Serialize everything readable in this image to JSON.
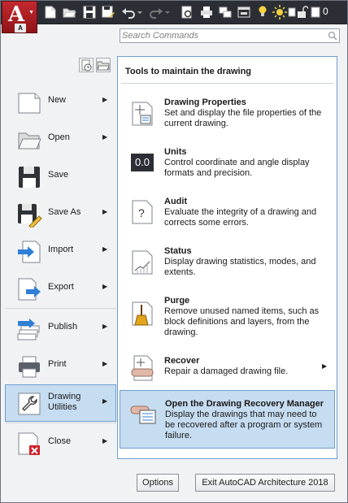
{
  "app_menu": {
    "letter": "A"
  },
  "quick_access": {
    "icons": [
      "new-icon",
      "open-icon",
      "save-icon",
      "save-as-icon",
      "undo-icon",
      "redo-icon",
      "plot-preview-icon",
      "plot-icon",
      "workspace-icon",
      "lightbulb-icon",
      "sun-icon",
      "layer-icon",
      "unlock-icon",
      "color-swatch-icon"
    ],
    "layer_value": "0"
  },
  "search": {
    "placeholder": "Search Commands",
    "value": ""
  },
  "menu": {
    "items": [
      {
        "label": "New",
        "icon": "new-document-icon",
        "has_arrow": true
      },
      {
        "label": "Open",
        "icon": "open-folder-icon",
        "has_arrow": true
      },
      {
        "label": "Save",
        "icon": "floppy-icon",
        "has_arrow": false
      },
      {
        "label": "Save As",
        "icon": "save-as-icon",
        "has_arrow": true
      },
      {
        "label": "Import",
        "icon": "import-icon",
        "has_arrow": true
      },
      {
        "label": "Export",
        "icon": "export-icon",
        "has_arrow": true
      },
      {
        "label": "Publish",
        "icon": "publish-icon",
        "has_arrow": true
      },
      {
        "label": "Print",
        "icon": "printer-icon",
        "has_arrow": true
      },
      {
        "label_line1": "Drawing",
        "label_line2": "Utilities",
        "icon": "wrench-icon",
        "has_arrow": true,
        "selected": true
      },
      {
        "label": "Close",
        "icon": "close-document-icon",
        "has_arrow": true
      }
    ]
  },
  "panel": {
    "title": "Tools to maintain the drawing",
    "items": [
      {
        "title": "Drawing Properties",
        "desc": "Set and display the file properties of the current drawing.",
        "icon": "drawing-properties-icon"
      },
      {
        "title": "Units",
        "desc": "Control coordinate and angle display formats and precision.",
        "icon": "units-icon",
        "icon_text": "0.0"
      },
      {
        "title": "Audit",
        "desc": "Evaluate the integrity of a drawing and corrects some errors.",
        "icon": "audit-icon",
        "icon_text": "?"
      },
      {
        "title": "Status",
        "desc": "Display drawing statistics, modes, and extents.",
        "icon": "status-icon"
      },
      {
        "title": "Purge",
        "desc": "Remove unused named items, such as block definitions and layers, from the drawing.",
        "icon": "purge-icon"
      },
      {
        "title": "Recover",
        "desc": "Repair a damaged drawing file.",
        "icon": "recover-icon",
        "has_arrow": true
      },
      {
        "title": "Open the Drawing Recovery Manager",
        "desc": "Display the drawings that may need to be recovered after a program or system failure.",
        "icon": "recovery-manager-icon",
        "selected": true
      }
    ]
  },
  "footer": {
    "options_label": "Options",
    "exit_label": "Exit AutoCAD Architecture 2018"
  },
  "colors": {
    "title_bar": "#2b2f35",
    "app_button": "#c5292f",
    "selection_fill": "#c6dcf1",
    "selection_border": "#6c9ed1"
  }
}
